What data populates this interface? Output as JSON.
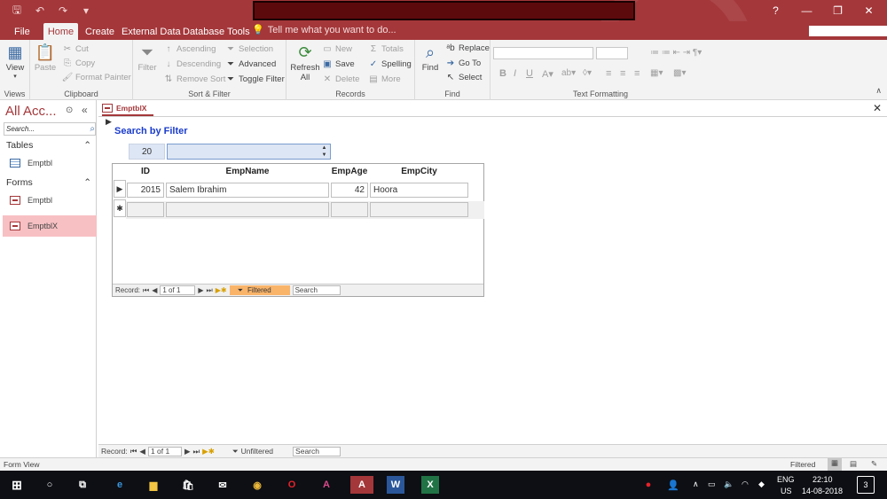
{
  "window": {
    "qat_save": "🖫",
    "qat_undo": "↶",
    "qat_redo": "↷",
    "qat_more": "▾",
    "help": "?",
    "min": "—",
    "restore": "❐",
    "close": "✕"
  },
  "tabs": [
    "File",
    "Home",
    "Create",
    "External Data",
    "Database Tools"
  ],
  "tell_me": "Tell me what you want to do...",
  "ribbon": {
    "views": {
      "view": "View",
      "label": "Views"
    },
    "clipboard": {
      "paste": "Paste",
      "cut": "Cut",
      "copy": "Copy",
      "format_painter": "Format Painter",
      "label": "Clipboard"
    },
    "sort_filter": {
      "filter": "Filter",
      "ascending": "Ascending",
      "descending": "Descending",
      "remove_sort": "Remove Sort",
      "selection": "Selection",
      "advanced": "Advanced",
      "toggle_filter": "Toggle Filter",
      "label": "Sort & Filter"
    },
    "records": {
      "refresh": "Refresh All",
      "new": "New",
      "save": "Save",
      "delete": "Delete",
      "totals": "Totals",
      "spelling": "Spelling",
      "more": "More",
      "label": "Records"
    },
    "find": {
      "find": "Find",
      "replace": "Replace",
      "goto": "Go To",
      "select": "Select",
      "label": "Find"
    },
    "text": {
      "bold": "B",
      "italic": "I",
      "underline": "U",
      "label": "Text Formatting"
    }
  },
  "nav": {
    "title": "All Acc...",
    "search_placeholder": "Search...",
    "sections": [
      {
        "name": "Tables",
        "items": [
          "Emptbl"
        ]
      },
      {
        "name": "Forms",
        "items": [
          "Emptbl",
          "EmptblX"
        ]
      }
    ]
  },
  "document": {
    "tab": "EmptblX",
    "heading": "Search by Filter",
    "filter_value": "20",
    "columns": [
      "ID",
      "EmpName",
      "EmpAge",
      "EmpCity"
    ],
    "rows": [
      {
        "id": "2015",
        "name": "Salem Ibrahim",
        "age": "42",
        "city": "Hoora"
      }
    ],
    "sub_nav": {
      "record": "Record:",
      "position": "1 of 1",
      "filter": "Filtered",
      "search": "Search"
    },
    "main_nav": {
      "record": "Record:",
      "position": "1 of 1",
      "filter": "Unfiltered",
      "search": "Search"
    }
  },
  "status": {
    "left": "Form View",
    "right": "Filtered"
  },
  "taskbar": {
    "lang": "ENG",
    "region": "US",
    "time": "22:10",
    "date": "14-08-2018",
    "notifications": "3"
  }
}
